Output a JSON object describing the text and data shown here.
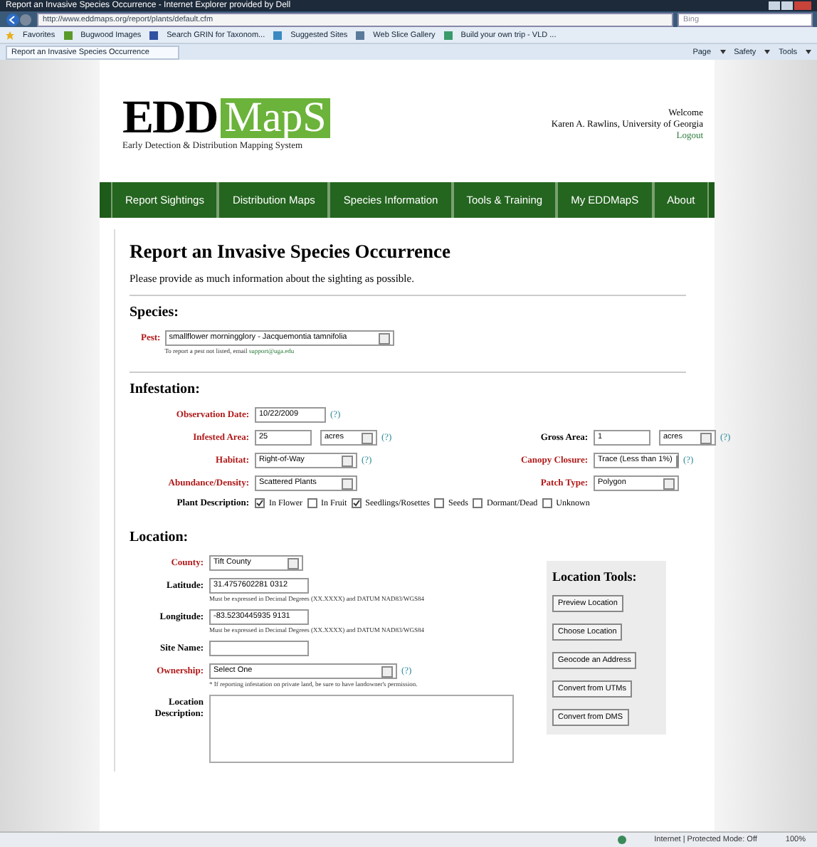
{
  "window": {
    "title": "Report an Invasive Species Occurrence - Internet Explorer provided by Dell"
  },
  "address_bar": {
    "url": "http://www.eddmaps.org/report/plants/default.cfm"
  },
  "search": {
    "placeholder": "Bing"
  },
  "favorites_bar": [
    "Favorites",
    "Bugwood Images",
    "Search GRIN for Taxonom...",
    "Suggested Sites",
    "Web Slice Gallery",
    "Build your own trip - VLD ..."
  ],
  "tab": {
    "title": "Report an Invasive Species Occurrence"
  },
  "command_bar": [
    "Page",
    "Safety",
    "Tools"
  ],
  "header": {
    "logo_left": "EDD",
    "logo_right": "MapS",
    "tagline": "Early Detection & Distribution Mapping System",
    "welcome": "Welcome",
    "user": "Karen A. Rawlins, University of Georgia",
    "logout": "Logout"
  },
  "nav": [
    "Report Sightings",
    "Distribution Maps",
    "Species Information",
    "Tools & Training",
    "My EDDMapS",
    "About"
  ],
  "form": {
    "title": "Report an Invasive Species Occurrence",
    "intro": "Please provide as much information about the sighting as possible.",
    "species": {
      "heading": "Species:",
      "label": "Pest:",
      "required": true,
      "value": "smallflower morningglory - Jacquemontia tamnifolia",
      "hint": "To report a pest not listed, email",
      "hint_link": "support@uga.edu"
    },
    "infestation": {
      "heading": "Infestation:",
      "rows": [
        [
          {
            "label": "Observation Date:",
            "required": true,
            "kind": "text",
            "value": "10/22/2009",
            "help": "(?)"
          }
        ],
        [
          {
            "label": "Infested Area:",
            "required": true,
            "kind": "text",
            "value": "25",
            "unit": "acres",
            "help": "(?)"
          },
          {
            "label": "Gross Area:",
            "required": false,
            "kind": "text",
            "value": "1",
            "unit": "acres",
            "help": "(?)"
          }
        ],
        [
          {
            "label": "Habitat:",
            "required": true,
            "kind": "select",
            "value": "Right-of-Way",
            "help": "(?)"
          },
          {
            "label": "Canopy Closure:",
            "required": true,
            "kind": "select",
            "value": "Trace (Less than 1%)",
            "help": "(?)"
          }
        ],
        [
          {
            "label": "Abundance/Density:",
            "required": true,
            "kind": "select",
            "value": "Scattered Plants"
          },
          {
            "label": "Patch Type:",
            "required": true,
            "kind": "select",
            "value": "Polygon"
          }
        ]
      ],
      "plant_description": {
        "label": "Plant Description:",
        "options": [
          {
            "label": "In Flower",
            "checked": true
          },
          {
            "label": "In Fruit",
            "checked": false
          },
          {
            "label": "Seedlings/Rosettes",
            "checked": true
          },
          {
            "label": "Seeds",
            "checked": false
          },
          {
            "label": "Dormant/Dead",
            "checked": false
          },
          {
            "label": "Unknown",
            "checked": false
          }
        ]
      }
    },
    "location": {
      "heading": "Location:",
      "fields": [
        {
          "label": "County:",
          "required": true,
          "kind": "select",
          "value": "Tift County"
        },
        {
          "label": "Latitude:",
          "required": false,
          "kind": "text",
          "value": "31.4757602281 0312",
          "hint": "Must be expressed in Decimal Degrees (XX.XXXX) and DATUM NAD83/WGS84"
        },
        {
          "label": "Longitude:",
          "required": false,
          "kind": "text",
          "value": "-83.5230445935 9131",
          "hint": "Must be expressed in Decimal Degrees (XX.XXXX) and DATUM NAD83/WGS84"
        },
        {
          "label": "Site Name:",
          "required": false,
          "kind": "text"
        },
        {
          "label": "Ownership:",
          "required": true,
          "kind": "select",
          "value": "Select One",
          "help": "(?)",
          "hint": "* If reporting infestation on private land, be sure to have landowner's permission."
        },
        {
          "label": "Location Description:",
          "required": false,
          "kind": "textarea"
        }
      ],
      "tools": {
        "heading": "Location Tools:",
        "buttons": [
          "Preview Location",
          "Choose Location",
          "Geocode an Address",
          "Convert from UTMs",
          "Convert from DMS"
        ]
      }
    }
  },
  "status_bar": {
    "zone": "Internet | Protected Mode: Off",
    "zoom": "100%"
  }
}
